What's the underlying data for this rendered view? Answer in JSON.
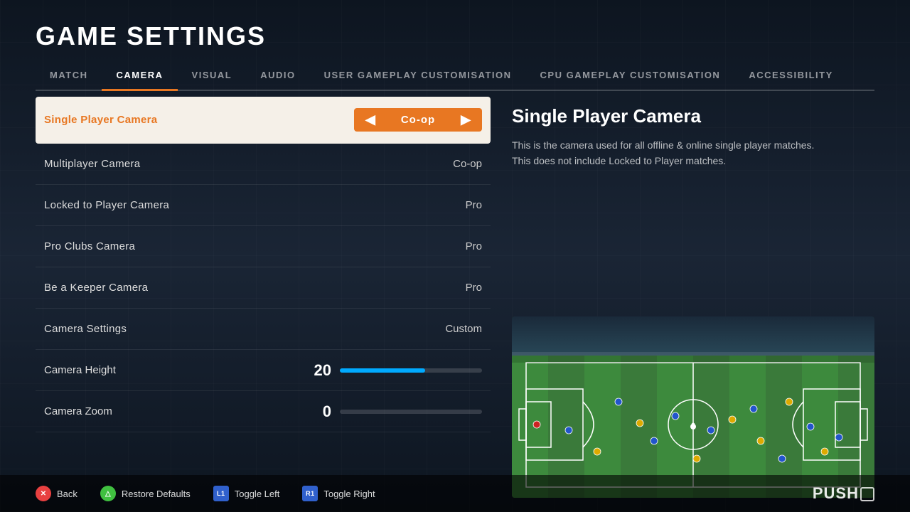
{
  "page": {
    "title": "GAME SETTINGS"
  },
  "tabs": [
    {
      "id": "match",
      "label": "MATCH",
      "active": false
    },
    {
      "id": "camera",
      "label": "CAMERA",
      "active": true
    },
    {
      "id": "visual",
      "label": "VISUAL",
      "active": false
    },
    {
      "id": "audio",
      "label": "AUDIO",
      "active": false
    },
    {
      "id": "user-gameplay",
      "label": "USER GAMEPLAY CUSTOMISATION",
      "active": false
    },
    {
      "id": "cpu-gameplay",
      "label": "CPU GAMEPLAY CUSTOMISATION",
      "active": false
    },
    {
      "id": "accessibility",
      "label": "ACCESSIBILITY",
      "active": false
    }
  ],
  "settings": [
    {
      "id": "single-player-camera",
      "label": "Single Player Camera",
      "value": "Co-op",
      "active": true,
      "type": "selector"
    },
    {
      "id": "multiplayer-camera",
      "label": "Multiplayer Camera",
      "value": "Co-op",
      "active": false,
      "type": "selector"
    },
    {
      "id": "locked-to-player-camera",
      "label": "Locked to Player Camera",
      "value": "Pro",
      "active": false,
      "type": "selector"
    },
    {
      "id": "pro-clubs-camera",
      "label": "Pro Clubs Camera",
      "value": "Pro",
      "active": false,
      "type": "selector"
    },
    {
      "id": "be-a-keeper-camera",
      "label": "Be a Keeper Camera",
      "value": "Pro",
      "active": false,
      "type": "selector"
    },
    {
      "id": "camera-settings",
      "label": "Camera Settings",
      "value": "Custom",
      "active": false,
      "type": "selector"
    }
  ],
  "sliders": [
    {
      "id": "camera-height",
      "label": "Camera Height",
      "value": 20,
      "fillPercent": 60,
      "type": "blue"
    },
    {
      "id": "camera-zoom",
      "label": "Camera Zoom",
      "value": 0,
      "fillPercent": 0,
      "type": "gray"
    }
  ],
  "detail": {
    "title": "Single Player Camera",
    "description": "This is the camera used for all offline & online single player matches.\nThis does not include Locked to Player matches."
  },
  "bottom": {
    "back_label": "Back",
    "restore_label": "Restore Defaults",
    "toggle_left_label": "Toggle Left",
    "toggle_right_label": "Toggle Right",
    "logo": "PUSH"
  }
}
